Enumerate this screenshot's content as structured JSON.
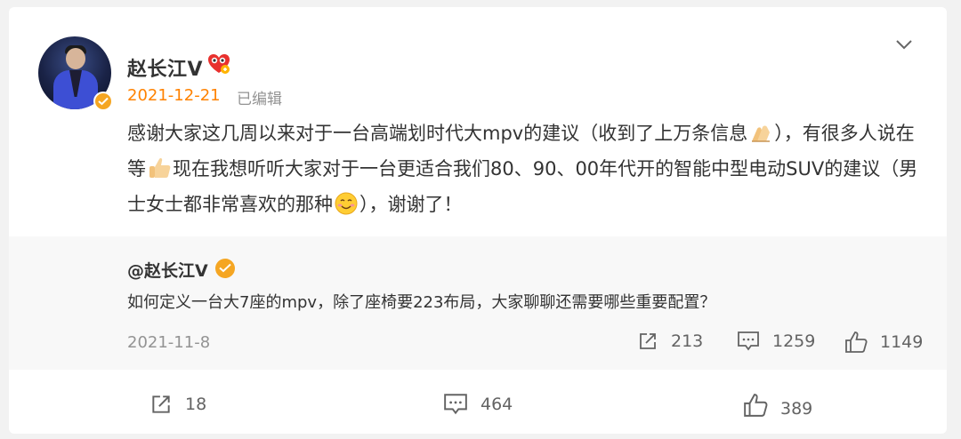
{
  "post": {
    "username": "赵长江V",
    "date": "2021-12-21",
    "edited": "已编辑",
    "text_part1": "感谢大家这几周以来对于一台高端划时代大mpv的建议（收到了上万条信息",
    "text_part2": "），有很多人说在等",
    "text_part3": "现在我想听听大家对于一台更适合我们80、90、00年代开的智能中型电动SUV的建议（男士女士都非常喜欢的那种",
    "text_part4": "），谢谢了！"
  },
  "repost": {
    "username": "@赵长江V",
    "text": "如何定义一台大7座的mpv，除了座椅要223布局，大家聊聊还需要哪些重要配置？",
    "date": "2021-11-8",
    "shares": "213",
    "comments": "1259",
    "likes": "1149"
  },
  "footer": {
    "shares": "18",
    "comments": "464",
    "likes": "389"
  },
  "colors": {
    "accent_date": "#ff8200",
    "badge": "#f5a623"
  }
}
